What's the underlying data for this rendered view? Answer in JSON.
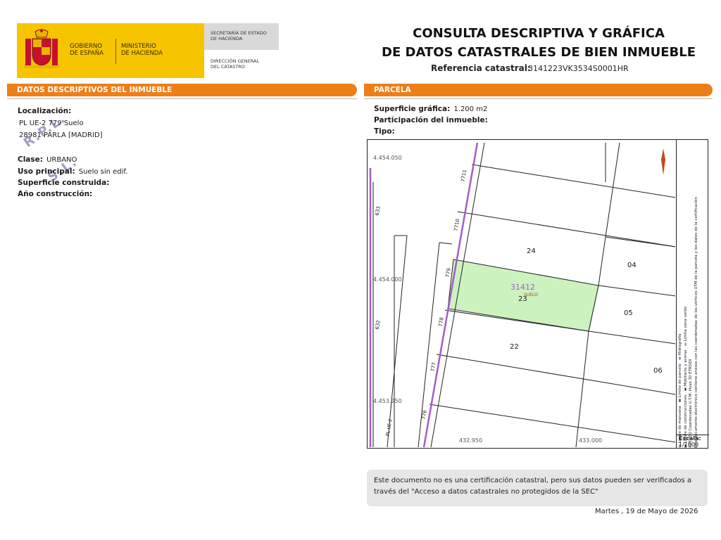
{
  "header": {
    "gobierno": [
      "GOBIERNO",
      "DE ESPAÑA"
    ],
    "ministerio": [
      "MINISTERIO",
      "DE HACIENDA"
    ],
    "secretaria": [
      "SECRETARÍA DE ESTADO",
      "DE HACIENDA"
    ],
    "direccion": [
      "DIRECCIÓN GENERAL",
      "DEL CATASTRO"
    ],
    "title_lines": [
      "CONSULTA DESCRIPTIVA Y GRÁFICA",
      "DE DATOS CATASTRALES DE BIEN INMUEBLE"
    ],
    "ref_label": "Referencia catastral:",
    "ref_value": "3141223VK3534S0001HR"
  },
  "left": {
    "section_title": "DATOS DESCRIPTIVOS DEL INMUEBLE",
    "localizacion_label": "Localización:",
    "address_1": "PL UE-2 779 Suelo",
    "address_2": "28981 PARLA [MADRID]",
    "watermark": "R.P.L. S.L.",
    "fields": [
      {
        "label": "Clase:",
        "value": "URBANO"
      },
      {
        "label": "Uso principal:",
        "value": "Suelo sin edif."
      },
      {
        "label": "Superficie construida:",
        "value": ""
      },
      {
        "label": "Año construcción:",
        "value": ""
      }
    ]
  },
  "right": {
    "section_title": "PARCELA",
    "fields": [
      {
        "label": "Superficie gráfica:",
        "value": "1.200 m2"
      },
      {
        "label": "Participación del inmueble:",
        "value": ""
      },
      {
        "label": "Tipo:",
        "value": ""
      }
    ]
  },
  "map": {
    "coord_y": [
      "4.454.050",
      "4.454.000",
      "4.453.950"
    ],
    "coord_x": [
      "432.950",
      "433.000"
    ],
    "street_numbers": [
      "633",
      "632",
      "7711",
      "7710",
      "779",
      "778",
      "777",
      "776"
    ],
    "street_name": "PL UE-2",
    "parcels": [
      "24",
      "04",
      "23",
      "05",
      "22",
      "06"
    ],
    "selected_parcel": "31412",
    "selected_use": "SUELO",
    "legend": {
      "items": [
        "Límite de manzana",
        "Límite de parcela",
        "Hidrografía",
        "Límite de construcciones",
        "Mobiliario y aceras",
        "Límite zona verde"
      ],
      "note_1": "433.050 Coordenadas U.T.M. Huso 30 ETRS89",
      "note_2": "Este documento electrónico contiene anexos con las coordenadas de los vértices UTM de la parcela y los datos de la certificación"
    },
    "scale_label": "Escala:",
    "scale_value": "1/1000"
  },
  "footer": {
    "notice": "Este documento no es una certificación catastral, pero sus datos pueden ser verificados a través del \"Acceso a datos catastrales no protegidos de la SEC\"",
    "date": "Martes , 19 de Mayo de 2026"
  },
  "colors": {
    "accent_orange": "#ee7f17",
    "logo_yellow": "#f6c500",
    "parcel_green": "#ccf2c0",
    "street_purple": "#a45cc8"
  }
}
